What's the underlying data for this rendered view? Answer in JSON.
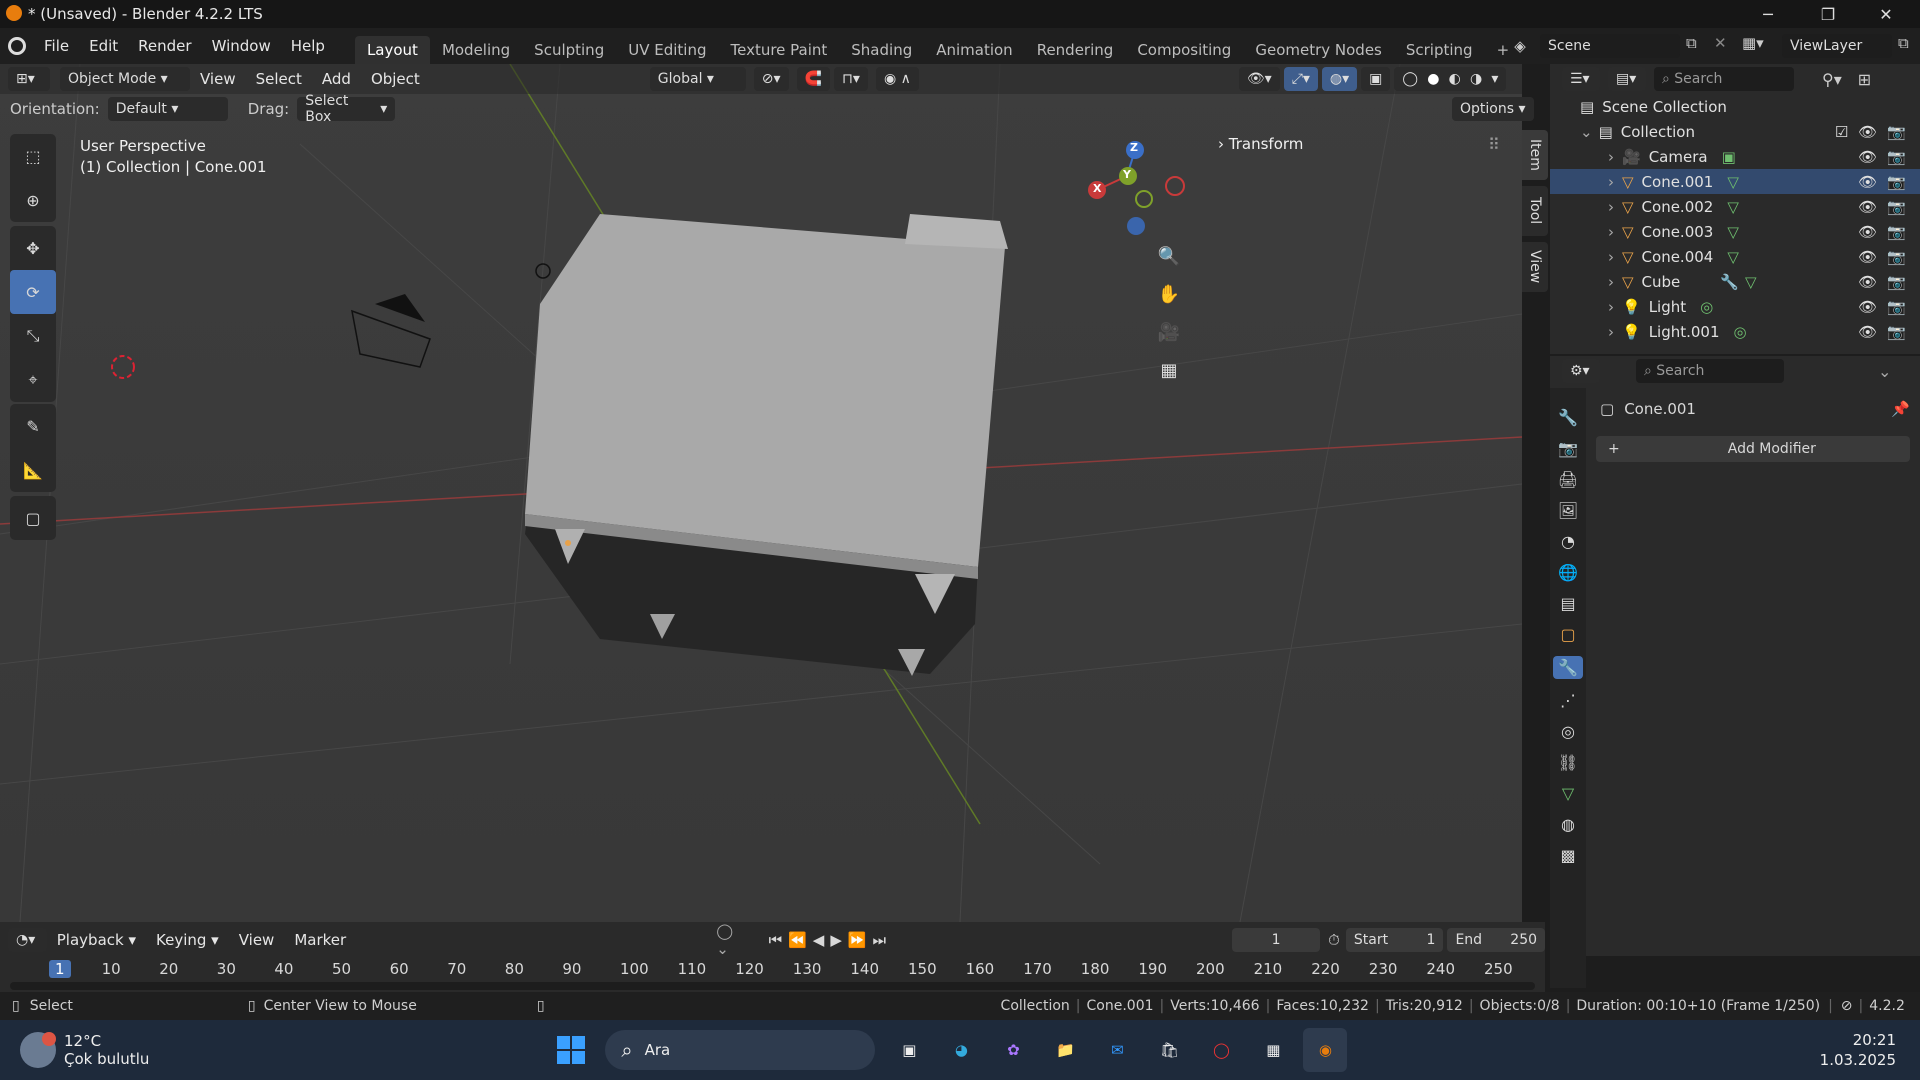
{
  "window": {
    "title": "* (Unsaved) - Blender 4.2.2 LTS",
    "minimize": "─",
    "maximize": "❐",
    "close": "✕"
  },
  "menu": {
    "items": [
      "File",
      "Edit",
      "Render",
      "Window",
      "Help"
    ]
  },
  "workspaces": {
    "tabs": [
      "Layout",
      "Modeling",
      "Sculpting",
      "UV Editing",
      "Texture Paint",
      "Shading",
      "Animation",
      "Rendering",
      "Compositing",
      "Geometry Nodes",
      "Scripting"
    ],
    "active": "Layout",
    "add": "+"
  },
  "scene": {
    "name": "Scene",
    "view_layer": "ViewLayer"
  },
  "viewport_header": {
    "mode": "Object Mode",
    "menus": [
      "View",
      "Select",
      "Add",
      "Object"
    ],
    "transform_orientation": "Global"
  },
  "viewport_header2": {
    "orientation_label": "Orientation:",
    "orientation_value": "Default",
    "drag_label": "Drag:",
    "drag_value": "Select Box",
    "options": "Options"
  },
  "viewport": {
    "perspective": "User Perspective",
    "context": "(1) Collection | Cone.001",
    "transform_panel": "Transform",
    "tabs": [
      "Item",
      "Tool",
      "View"
    ]
  },
  "gizmo": {
    "z": "Z",
    "y": "Y",
    "x": "X"
  },
  "outliner": {
    "search_placeholder": "Search",
    "root": "Scene Collection",
    "collection": "Collection",
    "items": [
      "Camera",
      "Cone.001",
      "Cone.002",
      "Cone.003",
      "Cone.004",
      "Cube",
      "Light",
      "Light.001"
    ]
  },
  "properties": {
    "search_placeholder": "Search",
    "object": "Cone.001",
    "add_modifier": "Add Modifier"
  },
  "timeline": {
    "menus": [
      "Playback",
      "Keying",
      "View",
      "Marker"
    ],
    "current_frame": "1",
    "start_label": "Start",
    "start": "1",
    "end_label": "End",
    "end": "250",
    "ticks": [
      "1",
      "10",
      "20",
      "30",
      "40",
      "50",
      "60",
      "70",
      "80",
      "90",
      "100",
      "110",
      "120",
      "130",
      "140",
      "150",
      "160",
      "170",
      "180",
      "190",
      "200",
      "210",
      "220",
      "230",
      "240",
      "250"
    ]
  },
  "status": {
    "left1": "Select",
    "left2": "Center View to Mouse",
    "collection": "Collection",
    "object": "Cone.001",
    "verts": "Verts:10,466",
    "faces": "Faces:10,232",
    "tris": "Tris:20,912",
    "objects": "Objects:0/8",
    "duration": "Duration: 00:10+10 (Frame 1/250)",
    "version": "4.2.2"
  },
  "taskbar": {
    "weather_temp": "12°C",
    "weather_desc": "Çok bulutlu",
    "search": "Ara",
    "time": "20:21",
    "date": "1.03.2025"
  },
  "colors": {
    "accent": "#4772b3",
    "blender_orange": "#e87d0d",
    "x_axis": "#c83a3a",
    "y_axis": "#7fa12a",
    "z_axis": "#3a6fc8"
  }
}
